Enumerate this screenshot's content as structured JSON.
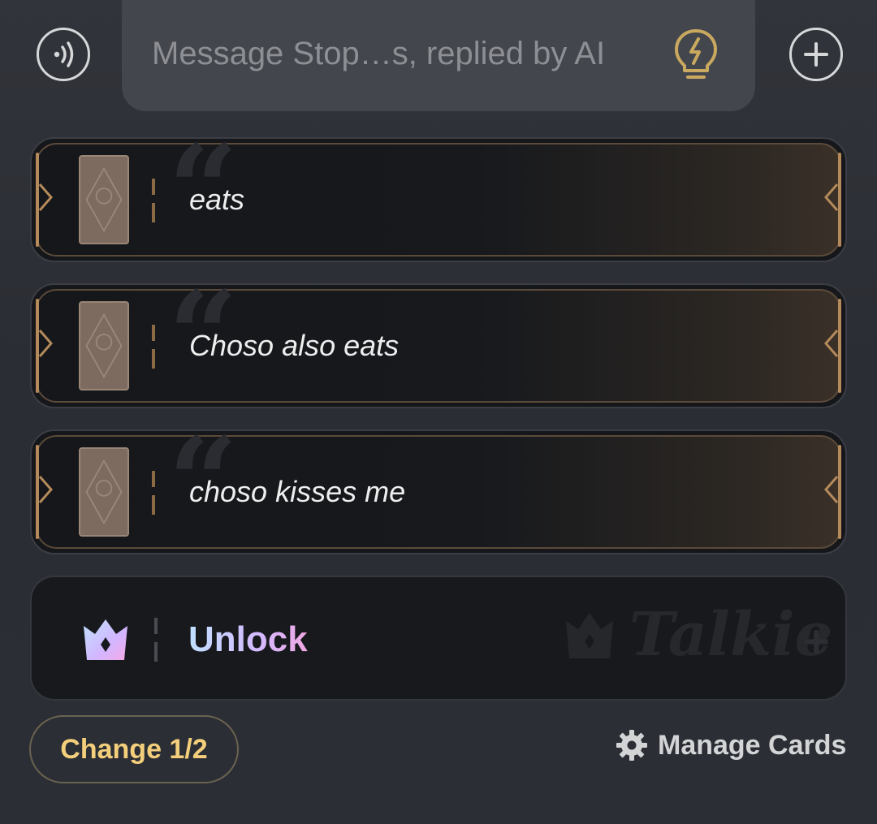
{
  "header": {
    "voice_icon": "voice-wave-icon",
    "message_placeholder": "Message Stop…s, replied by AI",
    "hint_icon": "lightbulb-icon",
    "add_icon": "plus-icon"
  },
  "cards": [
    {
      "text": "eats",
      "icon": "tarot-card-icon"
    },
    {
      "text": "Choso also eats",
      "icon": "tarot-card-icon"
    },
    {
      "text": "choso kisses me",
      "icon": "tarot-card-icon"
    }
  ],
  "unlock": {
    "label": "Unlock",
    "icon": "crown-icon"
  },
  "footer": {
    "change_label": "Change 1/2",
    "manage_label": "Manage Cards",
    "manage_icon": "gear-icon"
  },
  "colors": {
    "accent_gold": "#f3cf7c",
    "card_border_gold": "#b48a5a",
    "background": "#2c2f35"
  }
}
